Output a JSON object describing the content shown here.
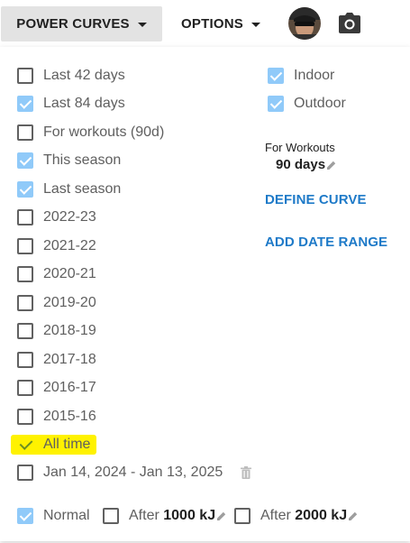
{
  "toolbar": {
    "power_curves_label": "POWER CURVES",
    "options_label": "OPTIONS"
  },
  "ranges": [
    {
      "label": "Last 42 days",
      "checked": false
    },
    {
      "label": "Last 84 days",
      "checked": true
    },
    {
      "label": "For workouts (90d)",
      "checked": false
    },
    {
      "label": "This season",
      "checked": true
    },
    {
      "label": "Last season",
      "checked": true
    },
    {
      "label": "2022-23",
      "checked": false
    },
    {
      "label": "2021-22",
      "checked": false
    },
    {
      "label": "2020-21",
      "checked": false
    },
    {
      "label": "2019-20",
      "checked": false
    },
    {
      "label": "2018-19",
      "checked": false
    },
    {
      "label": "2017-18",
      "checked": false
    },
    {
      "label": "2016-17",
      "checked": false
    },
    {
      "label": "2015-16",
      "checked": false
    },
    {
      "label": "All time",
      "checked": true
    },
    {
      "label": "Jan 14, 2024 - Jan 13, 2025",
      "checked": false
    }
  ],
  "environment": [
    {
      "label": "Indoor",
      "checked": true
    },
    {
      "label": "Outdoor",
      "checked": true
    }
  ],
  "for_workouts": {
    "label": "For Workouts",
    "value": "90 days"
  },
  "actions": {
    "define_curve": "DEFINE CURVE",
    "add_date_range": "ADD DATE RANGE"
  },
  "fatigue": {
    "normal_label": "Normal",
    "normal_checked": true,
    "after_prefix": "After",
    "after1_value": "1000 kJ",
    "after1_checked": false,
    "after2_value": "2000 kJ",
    "after2_checked": false
  },
  "colors": {
    "checkbox_checked": "#90caf9",
    "link": "#1e7ac8",
    "highlight": "#fff200"
  },
  "icons": {
    "caret": "chevron-down-icon",
    "camera": "camera-icon",
    "trash": "trash-icon",
    "pencil": "pencil-icon"
  }
}
